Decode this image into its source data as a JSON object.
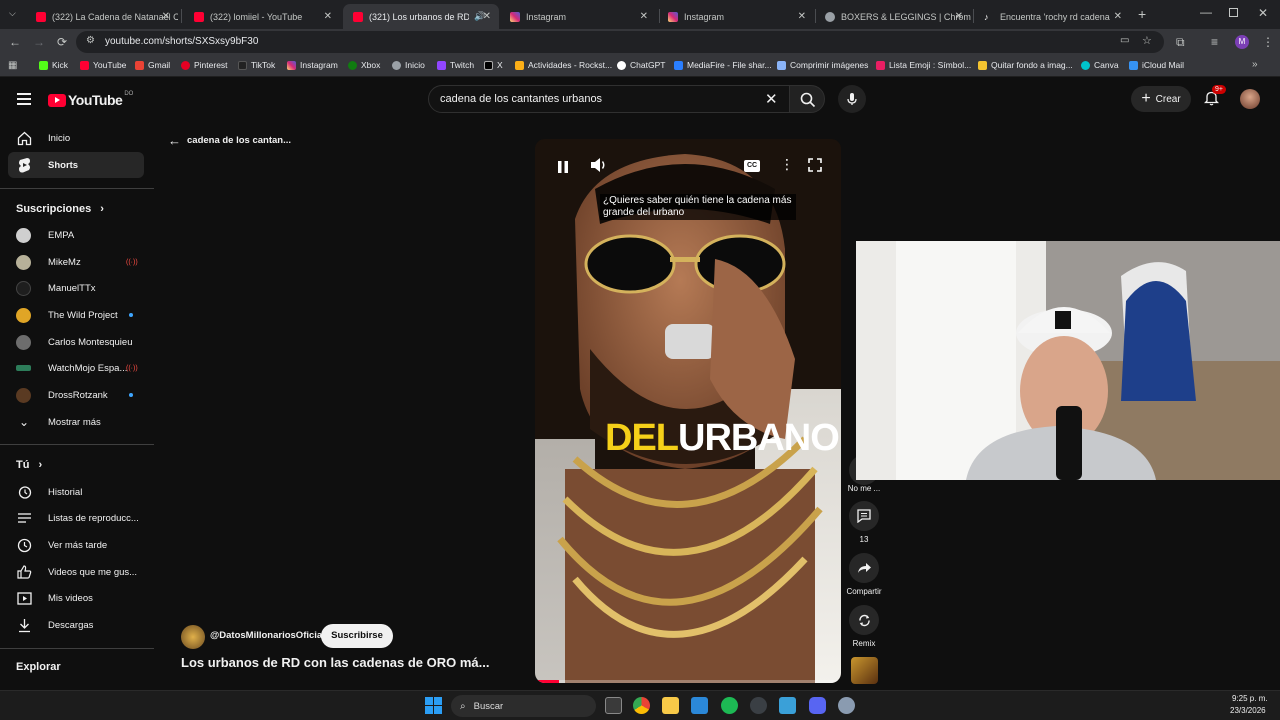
{
  "browser": {
    "tabs": [
      {
        "title": "(322) La Cadena de Natanael C",
        "favicon": "youtube-icon",
        "color": "#ff0033",
        "active": false
      },
      {
        "title": "(322) lomiiel - YouTube",
        "favicon": "youtube-icon",
        "color": "#ff0033",
        "active": false
      },
      {
        "title": "(321) Los urbanos de RD co",
        "favicon": "youtube-icon",
        "color": "#ff0033",
        "active": true
      },
      {
        "title": "Instagram",
        "favicon": "instagram-icon",
        "color": "#e1306c",
        "active": false
      },
      {
        "title": "Instagram",
        "favicon": "instagram-icon",
        "color": "#e1306c",
        "active": false
      },
      {
        "title": "BOXERS & LEGGINGS | Chrome",
        "favicon": "chrome-icon",
        "color": "#9aa0a6",
        "active": false
      },
      {
        "title": "Encuentra 'rochy rd cadena' en",
        "favicon": "tiktok-icon",
        "color": "#ffffff",
        "active": false
      }
    ],
    "url": "youtube.com/shorts/SXSxsy9bF30",
    "bookmarks": [
      {
        "label": "Kick",
        "color": "#53fc18"
      },
      {
        "label": "YouTube",
        "color": "#ff0033"
      },
      {
        "label": "Gmail",
        "color": "#ea4335"
      },
      {
        "label": "Pinterest",
        "color": "#e60023"
      },
      {
        "label": "TikTok",
        "color": "#ffffff"
      },
      {
        "label": "Instagram",
        "color": "#e1306c"
      },
      {
        "label": "Xbox",
        "color": "#107c10"
      },
      {
        "label": "Inicio",
        "color": "#9aa0a6"
      },
      {
        "label": "Twitch",
        "color": "#9146ff"
      },
      {
        "label": "X",
        "color": "#ffffff"
      },
      {
        "label": "Actividades - Rockst...",
        "color": "#fcaf17"
      },
      {
        "label": "ChatGPT",
        "color": "#ffffff"
      },
      {
        "label": "MediaFire - File shar...",
        "color": "#2a7fff"
      },
      {
        "label": "Comprimir imágenes",
        "color": "#8ab4f8"
      },
      {
        "label": "Lista Emoji : Símbol...",
        "color": "#e91e63"
      },
      {
        "label": "Quitar fondo a imag...",
        "color": "#f4c430"
      },
      {
        "label": "Canva",
        "color": "#00c4cc"
      },
      {
        "label": "iCloud Mail",
        "color": "#3693f3"
      }
    ]
  },
  "youtube": {
    "logo_text": "YouTube",
    "country_code": "DO",
    "search_value": "cadena de los cantantes urbanos",
    "create_label": "Crear",
    "notif_count": "9+",
    "back_label": "cadena de los cantan...",
    "sidebar": {
      "main": [
        {
          "label": "Inicio",
          "icon": "home-icon"
        },
        {
          "label": "Shorts",
          "icon": "shorts-icon",
          "selected": true
        }
      ],
      "subs_title": "Suscripciones",
      "subs": [
        {
          "label": "EMPA",
          "dot": ""
        },
        {
          "label": "MikeMz",
          "dot": "live"
        },
        {
          "label": "ManuelTTx",
          "dot": ""
        },
        {
          "label": "The Wild Project",
          "dot": "new"
        },
        {
          "label": "Carlos Montesquieu",
          "dot": ""
        },
        {
          "label": "WatchMojo Espa...",
          "dot": "live"
        },
        {
          "label": "DrossRotzank",
          "dot": "new"
        }
      ],
      "show_more": "Mostrar más",
      "you_title": "Tú",
      "you": [
        {
          "label": "Historial",
          "icon": "history-icon"
        },
        {
          "label": "Listas de reproducc...",
          "icon": "playlist-icon"
        },
        {
          "label": "Ver más tarde",
          "icon": "clock-icon"
        },
        {
          "label": "Videos que me gus...",
          "icon": "like-icon"
        },
        {
          "label": "Mis videos",
          "icon": "video-icon"
        },
        {
          "label": "Descargas",
          "icon": "download-icon"
        }
      ],
      "explore_title": "Explorar"
    },
    "short": {
      "caption": "¿Quieres saber quién tiene la cadena más grande del urbano",
      "overlay_word_a": "DEL",
      "overlay_word_b": "URBANO",
      "channel": "@DatosMillonariosOficial",
      "subscribe": "Suscribirse",
      "title": "Los urbanos de RD con las cadenas de ORO má...",
      "actions": {
        "dislike_label": "No me ...",
        "comments_count": "13",
        "share_label": "Compartir",
        "remix_label": "Remix"
      }
    }
  },
  "taskbar": {
    "search_placeholder": "Buscar",
    "time": "9:25 p. m.",
    "date": "23/3/2026"
  }
}
